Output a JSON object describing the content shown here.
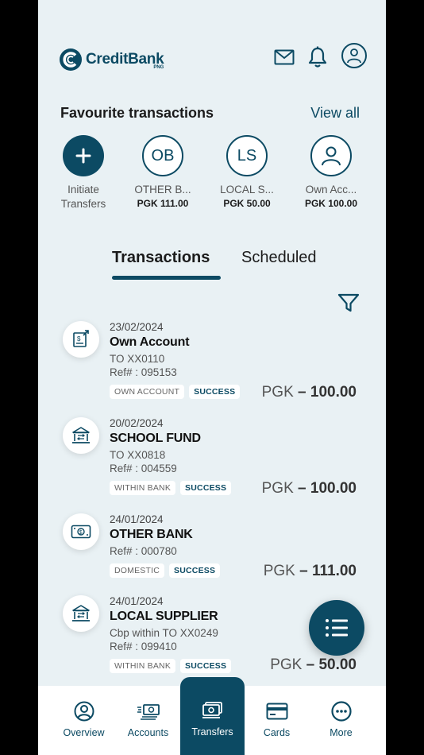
{
  "header": {
    "brand": "CreditBank",
    "brand_sub": "PNG"
  },
  "favourites": {
    "title": "Favourite transactions",
    "view_all": "View all",
    "items": [
      {
        "initials": "+",
        "line1": "Initiate",
        "line2": "Transfers"
      },
      {
        "initials": "OB",
        "line1": "OTHER B...",
        "amount": "PGK 111.00"
      },
      {
        "initials": "LS",
        "line1": "LOCAL S...",
        "amount": "PGK 50.00"
      },
      {
        "initials": "",
        "line1": "Own Acc...",
        "amount": "PGK 100.00"
      }
    ]
  },
  "tabs": {
    "transactions": "Transactions",
    "scheduled": "Scheduled"
  },
  "transactions": [
    {
      "date": "23/02/2024",
      "name": "Own Account",
      "line1": "TO XX0110",
      "ref": "Ref# : 095153",
      "type": "OWN ACCOUNT",
      "status": "SUCCESS",
      "currency": "PGK",
      "amount": "– 100.00",
      "icon": "document-dollar-icon"
    },
    {
      "date": "20/02/2024",
      "name": "SCHOOL FUND",
      "line1": "TO XX0818",
      "ref": "Ref# : 004559",
      "type": "WITHIN BANK",
      "status": "SUCCESS",
      "currency": "PGK",
      "amount": "– 100.00",
      "icon": "bank-transfer-icon"
    },
    {
      "date": "24/01/2024",
      "name": "OTHER BANK",
      "ref": "Ref# : 000780",
      "type": "DOMESTIC",
      "status": "SUCCESS",
      "currency": "PGK",
      "amount": "– 111.00",
      "icon": "cash-icon"
    },
    {
      "date": "24/01/2024",
      "name": "LOCAL SUPPLIER",
      "line1": "Cbp within TO XX0249",
      "ref": "Ref# : 099410",
      "type": "WITHIN BANK",
      "status": "SUCCESS",
      "currency": "PGK",
      "amount": "– 50.00",
      "icon": "bank-transfer-icon"
    }
  ],
  "nav": [
    {
      "label": "Overview",
      "icon": "user-circle-icon"
    },
    {
      "label": "Accounts",
      "icon": "money-stack-icon"
    },
    {
      "label": "Transfers",
      "icon": "transfer-icon"
    },
    {
      "label": "Cards",
      "icon": "card-icon"
    },
    {
      "label": "More",
      "icon": "more-icon"
    }
  ],
  "colors": {
    "primary": "#0c4a63",
    "background": "#e9f1f4"
  }
}
